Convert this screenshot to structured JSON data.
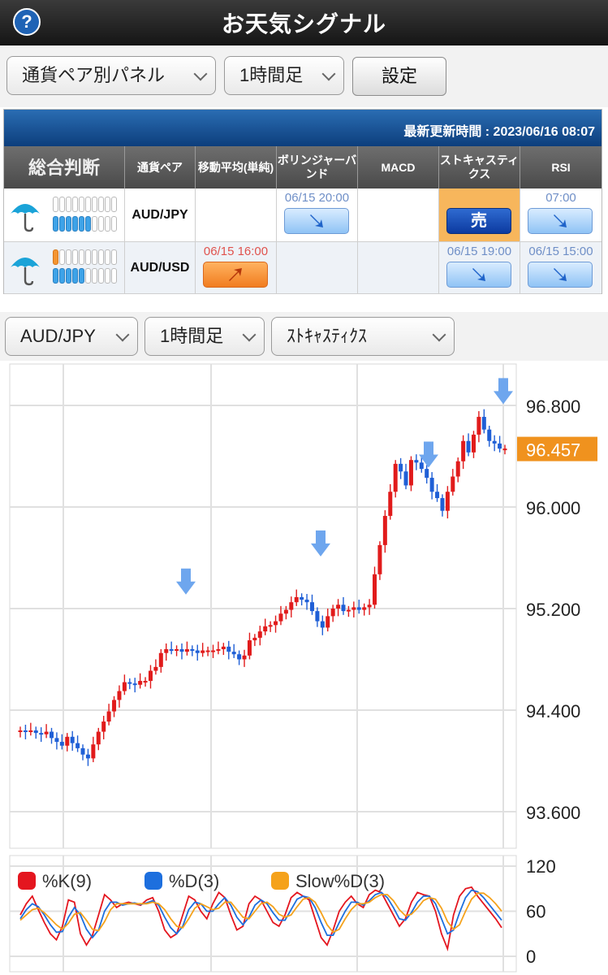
{
  "header": {
    "title": "お天気シグナル",
    "help_icon": "?"
  },
  "controls": {
    "panel_select": "通貨ペア別パネル",
    "timeframe_select": "1時間足",
    "settings_button": "設定"
  },
  "signal_panel": {
    "last_updated": "最新更新時間 : 2023/06/16 08:07",
    "columns": [
      "総合判断",
      "通貨ペア",
      "移動平均(単純)",
      "ボリンジャーバンド",
      "MACD",
      "ストキャスティクス",
      "RSI"
    ],
    "rows": [
      {
        "weather_icon": "umbrella-icon",
        "pair": "AUD/JPY",
        "gauge_top_orange": 0,
        "gauge_bottom_blue": 6,
        "signals": {
          "ma": {
            "time": "",
            "type": ""
          },
          "bb": {
            "time": "06/15 20:00",
            "type": "down-arrow"
          },
          "macd": {
            "time": "",
            "type": ""
          },
          "stoch": {
            "time": "",
            "type": "sell",
            "label": "売"
          },
          "rsi": {
            "time": "07:00",
            "type": "down-arrow"
          }
        }
      },
      {
        "weather_icon": "umbrella-icon",
        "pair": "AUD/USD",
        "gauge_top_orange": 1,
        "gauge_bottom_blue": 5,
        "signals": {
          "ma": {
            "time": "06/15 16:00",
            "type": "up-arrow"
          },
          "bb": {
            "time": "",
            "type": ""
          },
          "macd": {
            "time": "",
            "type": ""
          },
          "stoch": {
            "time": "06/15 19:00",
            "type": "down-arrow"
          },
          "rsi": {
            "time": "06/15 15:00",
            "type": "down-arrow"
          }
        }
      }
    ]
  },
  "chart_controls": {
    "pair_select": "AUD/JPY",
    "timeframe_select": "1時間足",
    "indicator_select": "ｽﾄｷｬｽﾃｨｸｽ"
  },
  "chart_data": [
    {
      "type": "candlestick",
      "y_axis_ticks": [
        "96.800",
        "96.000",
        "95.200",
        "94.400",
        "93.600"
      ],
      "ylim": [
        93.6,
        96.8
      ],
      "current_price": "96.457",
      "current_price_color": "#f0921e",
      "up_color": "#e11b1b",
      "down_color": "#1f5fd6",
      "signal_arrow_color": "#6ea6ee",
      "closes": [
        94.24,
        94.23,
        94.24,
        94.22,
        94.21,
        94.23,
        94.18,
        94.15,
        94.12,
        94.19,
        94.14,
        94.1,
        94.05,
        94.02,
        94.13,
        94.23,
        94.31,
        94.39,
        94.48,
        94.55,
        94.62,
        94.61,
        94.6,
        94.63,
        94.63,
        94.71,
        94.74,
        94.85,
        94.88,
        94.87,
        94.88,
        94.86,
        94.88,
        94.87,
        94.85,
        94.87,
        94.87,
        94.87,
        94.88,
        94.9,
        94.86,
        94.84,
        94.8,
        94.83,
        94.95,
        94.97,
        95.02,
        95.06,
        95.07,
        95.1,
        95.16,
        95.19,
        95.25,
        95.29,
        95.27,
        95.25,
        95.18,
        95.1,
        95.05,
        95.14,
        95.2,
        95.23,
        95.18,
        95.19,
        95.21,
        95.19,
        95.21,
        95.23,
        95.47,
        95.7,
        95.93,
        96.12,
        96.34,
        96.28,
        96.17,
        96.37,
        96.35,
        96.3,
        96.23,
        96.12,
        96.07,
        95.97,
        96.12,
        96.24,
        96.36,
        96.52,
        96.43,
        96.57,
        96.71,
        96.61,
        96.52,
        96.5,
        96.46,
        96.46
      ],
      "sell_signal_arrows": [
        95.4,
        95.7,
        96.4,
        96.9
      ]
    },
    {
      "type": "line",
      "y_axis_ticks": [
        "120",
        "60",
        "0"
      ],
      "ylim": [
        0,
        120
      ],
      "series": [
        {
          "name": "%K(9)",
          "color": "#e4161f",
          "values": [
            55,
            70,
            80,
            62,
            45,
            30,
            22,
            40,
            75,
            72,
            30,
            15,
            28,
            55,
            82,
            75,
            65,
            70,
            72,
            70,
            68,
            75,
            78,
            60,
            35,
            25,
            30,
            55,
            80,
            75,
            60,
            50,
            70,
            85,
            78,
            55,
            35,
            40,
            70,
            80,
            75,
            60,
            45,
            40,
            55,
            78,
            85,
            80,
            75,
            50,
            25,
            15,
            35,
            60,
            72,
            80,
            70,
            65,
            82,
            88,
            85,
            70,
            55,
            40,
            50,
            72,
            85,
            82,
            80,
            60,
            30,
            10,
            55,
            80,
            90,
            92,
            80,
            70,
            60,
            50,
            38
          ]
        },
        {
          "name": "%D(3)",
          "color": "#1d6fde",
          "values": [
            50,
            62,
            70,
            66,
            55,
            42,
            32,
            33,
            52,
            65,
            55,
            36,
            25,
            35,
            60,
            72,
            72,
            68,
            70,
            71,
            69,
            71,
            74,
            68,
            52,
            38,
            30,
            40,
            62,
            72,
            70,
            60,
            60,
            70,
            78,
            68,
            52,
            42,
            52,
            68,
            75,
            70,
            58,
            48,
            48,
            62,
            76,
            80,
            78,
            65,
            45,
            28,
            28,
            45,
            60,
            72,
            72,
            68,
            74,
            82,
            85,
            78,
            65,
            50,
            48,
            58,
            72,
            80,
            80,
            70,
            50,
            30,
            35,
            58,
            78,
            88,
            86,
            78,
            68,
            58,
            48
          ]
        },
        {
          "name": "Slow%D(3)",
          "color": "#f5a21b",
          "values": [
            48,
            55,
            62,
            64,
            58,
            50,
            42,
            36,
            44,
            56,
            58,
            48,
            36,
            34,
            46,
            62,
            70,
            70,
            70,
            70,
            70,
            70,
            72,
            70,
            62,
            50,
            40,
            38,
            50,
            64,
            70,
            66,
            62,
            64,
            72,
            72,
            62,
            52,
            50,
            60,
            70,
            72,
            66,
            56,
            52,
            55,
            66,
            76,
            78,
            72,
            58,
            42,
            32,
            36,
            50,
            62,
            70,
            70,
            72,
            78,
            82,
            82,
            74,
            62,
            54,
            56,
            64,
            74,
            78,
            76,
            64,
            46,
            36,
            42,
            60,
            76,
            84,
            84,
            78,
            70,
            60
          ]
        }
      ]
    }
  ]
}
